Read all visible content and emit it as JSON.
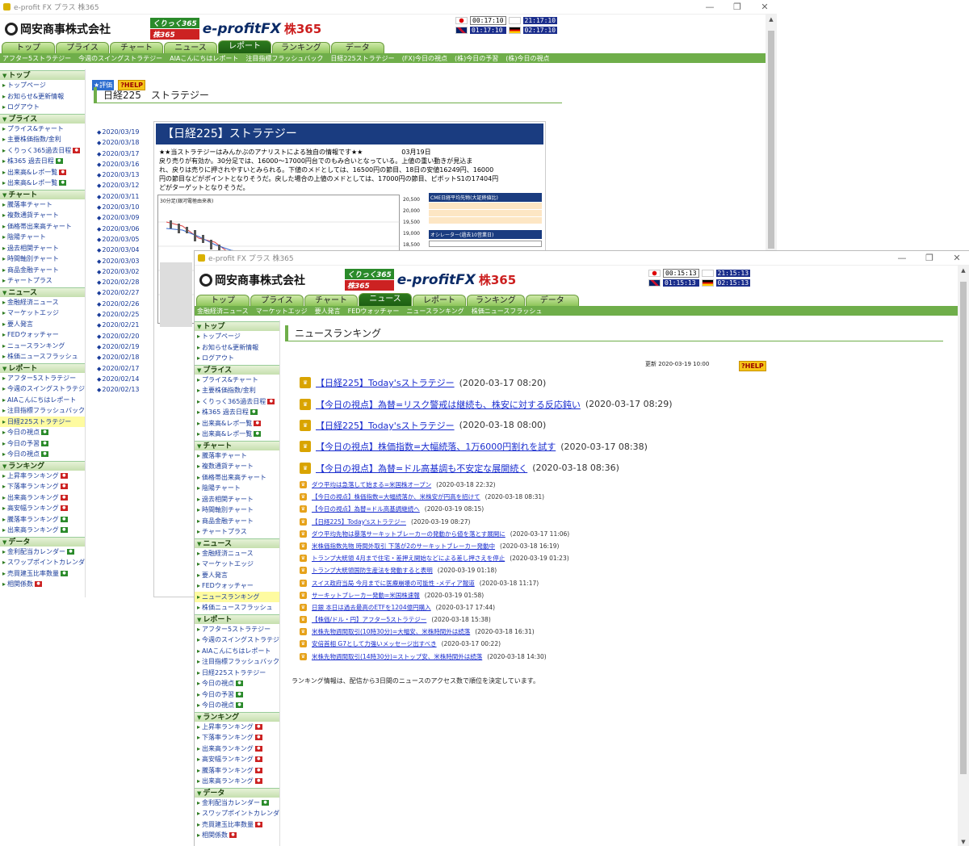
{
  "back": {
    "title": "e-profit FX プラス 株365",
    "company": "岡安商事株式会社",
    "brand": {
      "kurikku": "くりっく365",
      "kabu": "株365",
      "eprofit": "e-profitFX",
      "kabu365": "株365"
    },
    "clocks": [
      "00:17:10",
      "21:17:10",
      "01:17:10",
      "02:17:10"
    ],
    "tabs": [
      "トップ",
      "プライス",
      "チャート",
      "ニュース",
      "レポート",
      "ランキング",
      "データ"
    ],
    "subnav": [
      "アフター5ストラテジー",
      "今週のスイングストラテジー",
      "AIAこんにちはレポート",
      "注目指標フラッシュバック",
      "日経225ストラテジー",
      "(FX)今日の視点",
      "(株)今日の予習",
      "(株)今日の視点"
    ],
    "hyoka": "★評価",
    "help": "?HELP",
    "page_title": "日経225　ストラテジー",
    "dates": [
      "2020/03/19",
      "2020/03/18",
      "2020/03/17",
      "2020/03/16",
      "2020/03/13",
      "2020/03/12",
      "2020/03/11",
      "2020/03/10",
      "2020/03/09",
      "2020/03/06",
      "2020/03/05",
      "2020/03/04",
      "2020/03/03",
      "2020/03/02",
      "2020/02/28",
      "2020/02/27",
      "2020/02/26",
      "2020/02/25",
      "2020/02/21",
      "2020/02/20",
      "2020/02/19",
      "2020/02/18",
      "2020/02/17",
      "2020/02/14",
      "2020/02/13"
    ],
    "strat_banner": "【日経225】ストラテジー",
    "strat_lines": [
      "★★当ストラテジーはみんかぶのアナリストによる独自の情報です★★　　　　　　03月19日",
      "戻り売りが有効か。30分足では、16000～17000円台でのもみ合いとなっている。上値の重い動きが見込ま",
      "れ、戻りは売りに押されやすいとみられる。下値のメドとしては、16500円の節目、18日の安値16249円、16000",
      "円の節目などがポイントとなりそうだ。戻した場合の上値のメドとしては、17000円の節目、ピボットS1の17404円",
      "どがターゲットとなりそうだ。"
    ],
    "chart_heading": "30分足(銀河電極由来表)",
    "cme_heading": "CME日経平均先物(大証終値比)",
    "osc_heading": "オシレーター(過去10営業日)",
    "y_ticks": [
      "20,500",
      "20,000",
      "19,500",
      "19,000",
      "18,500"
    ],
    "sidebar": [
      {
        "sec": "トップ",
        "items": [
          {
            "t": "トップページ"
          },
          {
            "t": "お知らせ&更新情報"
          },
          {
            "t": "ログアウト"
          }
        ]
      },
      {
        "sec": "プライス",
        "items": [
          {
            "t": "プライス&チャート"
          },
          {
            "t": "主要株価指数/金利"
          },
          {
            "t": "くりっく365過去日程",
            "b": "r"
          },
          {
            "t": "株365 過去日程",
            "b": "g"
          },
          {
            "t": "出来高&レポ一覧",
            "b": "r"
          },
          {
            "t": "出来高&レポ一覧",
            "b": "g"
          }
        ]
      },
      {
        "sec": "チャート",
        "items": [
          {
            "t": "騰落率チャート"
          },
          {
            "t": "複数通貨チャート"
          },
          {
            "t": "価格帯出来高チャート"
          },
          {
            "t": "陰陽チャート"
          },
          {
            "t": "過去相関チャート"
          },
          {
            "t": "時間軸別チャート"
          },
          {
            "t": "商品金融チャート"
          },
          {
            "t": "チャートプラス"
          }
        ]
      },
      {
        "sec": "ニュース",
        "items": [
          {
            "t": "金融経済ニュース"
          },
          {
            "t": "マーケットエッジ"
          },
          {
            "t": "要人発言"
          },
          {
            "t": "FEDウォッチャー"
          },
          {
            "t": "ニュースランキング"
          },
          {
            "t": "株価ニュースフラッシュ"
          }
        ]
      },
      {
        "sec": "レポート",
        "items": [
          {
            "t": "アフター5ストラテジー"
          },
          {
            "t": "今週のスイングストラテジー"
          },
          {
            "t": "AIAこんにちはレポート"
          },
          {
            "t": "注目指標フラッシュバック"
          },
          {
            "t": "日経225ストラテジー",
            "hl": true
          },
          {
            "t": "今日の視点",
            "b": "g"
          },
          {
            "t": "今日の予習",
            "b": "g"
          },
          {
            "t": "今日の視点",
            "b": "g"
          }
        ]
      },
      {
        "sec": "ランキング",
        "items": [
          {
            "t": "上昇率ランキング",
            "b": "r"
          },
          {
            "t": "下落率ランキング",
            "b": "r"
          },
          {
            "t": "出来高ランキング",
            "b": "r"
          },
          {
            "t": "高安幅ランキング",
            "b": "r"
          },
          {
            "t": "騰落率ランキング",
            "b": "g"
          },
          {
            "t": "出来高ランキング",
            "b": "g"
          }
        ]
      },
      {
        "sec": "データ",
        "items": [
          {
            "t": "金利配当カレンダー",
            "b": "g"
          },
          {
            "t": "スワップポイントカレンダー",
            "b": "r"
          },
          {
            "t": "売買建玉比率数量",
            "b": "g"
          },
          {
            "t": "相関係数",
            "b": "r"
          }
        ]
      }
    ]
  },
  "front": {
    "title": "e-profit FX プラス 株365",
    "company": "岡安商事株式会社",
    "brand": {
      "kurikku": "くりっく365",
      "kabu": "株365",
      "eprofit": "e-profitFX",
      "kabu365": "株365"
    },
    "clocks": [
      "00:15:13",
      "21:15:13",
      "01:15:13",
      "02:15:13"
    ],
    "tabs": [
      "トップ",
      "プライス",
      "チャート",
      "ニュース",
      "レポート",
      "ランキング",
      "データ"
    ],
    "subnav": [
      "金融経済ニュース",
      "マーケットエッジ",
      "要人発言",
      "FEDウォッチャー",
      "ニュースランキング",
      "株価ニュースフラッシュ"
    ],
    "page_title": "ニュースランキング",
    "updated": "更新 2020-03-19 10:00",
    "help": "?HELP",
    "rankings": [
      {
        "title": "【日経225】Today'sストラテジー",
        "date": "(2020-03-17 08:20)"
      },
      {
        "title": "【今日の視点】為替=リスク警戒は継続も、株安に対する反応鈍い",
        "date": "(2020-03-17 08:29)"
      },
      {
        "title": "【日経225】Today'sストラテジー",
        "date": "(2020-03-18 08:00)"
      },
      {
        "title": "【今日の視点】株価指数=大幅続落、1万6000円割れを試す",
        "date": "(2020-03-17 08:38)"
      },
      {
        "title": "【今日の視点】為替=ドル高基調も不安定な展開続く",
        "date": "(2020-03-18 08:36)"
      },
      {
        "title": "ダウ平均は急落して始まる=米国株オープン",
        "date": "(2020-03-18 22:32)"
      },
      {
        "title": "【今日の視点】株価指数=大幅続落か、米株安が円高を招けて",
        "date": "(2020-03-18 08:31)"
      },
      {
        "title": "【今日の視点】為替=ドル高基調継続へ",
        "date": "(2020-03-19 08:15)"
      },
      {
        "title": "【日経225】Today'sストラテジー",
        "date": "(2020-03-19 08:27)"
      },
      {
        "title": "ダウ平均先物は暴落サーキットブレーカーの発動から値を落とす展開に",
        "date": "(2020-03-17 11:06)"
      },
      {
        "title": "米株価指数先物 時間外取引 下落が2のサーキットブレーカー発動中",
        "date": "(2020-03-18 16:19)"
      },
      {
        "title": "トランプ大統領 4月まで住宅・差押え開始などによる差し押さえを停止",
        "date": "(2020-03-19 01:23)"
      },
      {
        "title": "トランプ大統領国防生産法を発動すると表明",
        "date": "(2020-03-19 01:18)"
      },
      {
        "title": "スイス政府当局 今月までに医療崩壊の可能性 -メディア報道",
        "date": "(2020-03-18 11:17)"
      },
      {
        "title": "サーキットブレーカー発動=米国株速報",
        "date": "(2020-03-19 01:58)"
      },
      {
        "title": "日銀 本日は過去最高のETFを1204億円購入",
        "date": "(2020-03-17 17:44)"
      },
      {
        "title": "【株価/ドル・円】アフター5ストラテジー",
        "date": "(2020-03-18 15:38)"
      },
      {
        "title": "米株先物週間取引(10時30分)=大幅安、米株時間外は続落",
        "date": "(2020-03-18 16:31)"
      },
      {
        "title": "安倍首相 G7として力強いメッセージ出すべき",
        "date": "(2020-03-17 00:22)"
      },
      {
        "title": "米株先物週間取引(14時30分)=ストップ安、米株時間外は続落",
        "date": "(2020-03-18 14:30)"
      }
    ],
    "footnote": "ランキング情報は、配信から3日間のニュースのアクセス数で順位を決定しています。",
    "sidebar": [
      {
        "sec": "トップ",
        "items": [
          {
            "t": "トップページ"
          },
          {
            "t": "お知らせ&更新情報"
          },
          {
            "t": "ログアウト"
          }
        ]
      },
      {
        "sec": "プライス",
        "items": [
          {
            "t": "プライス&チャート"
          },
          {
            "t": "主要株価指数/金利"
          },
          {
            "t": "くりっく365過去日程",
            "b": "r"
          },
          {
            "t": "株365 過去日程",
            "b": "g"
          },
          {
            "t": "出来高&レポ一覧",
            "b": "r"
          },
          {
            "t": "出来高&レポ一覧",
            "b": "g"
          }
        ]
      },
      {
        "sec": "チャート",
        "items": [
          {
            "t": "騰落率チャート"
          },
          {
            "t": "複数通貨チャート"
          },
          {
            "t": "価格帯出来高チャート"
          },
          {
            "t": "陰陽チャート"
          },
          {
            "t": "過去相関チャート"
          },
          {
            "t": "時間軸別チャート"
          },
          {
            "t": "商品金融チャート"
          },
          {
            "t": "チャートプラス"
          }
        ]
      },
      {
        "sec": "ニュース",
        "items": [
          {
            "t": "金融経済ニュース"
          },
          {
            "t": "マーケットエッジ"
          },
          {
            "t": "要人発言"
          },
          {
            "t": "FEDウォッチャー"
          },
          {
            "t": "ニュースランキング",
            "hl": true
          },
          {
            "t": "株価ニュースフラッシュ"
          }
        ]
      },
      {
        "sec": "レポート",
        "items": [
          {
            "t": "アフター5ストラテジー"
          },
          {
            "t": "今週のスイングストラテジー"
          },
          {
            "t": "AIAこんにちはレポート"
          },
          {
            "t": "注目指標フラッシュバック"
          },
          {
            "t": "日経225ストラテジー"
          },
          {
            "t": "今日の視点",
            "b": "g"
          },
          {
            "t": "今日の予習",
            "b": "g"
          },
          {
            "t": "今日の視点",
            "b": "g"
          }
        ]
      },
      {
        "sec": "ランキング",
        "items": [
          {
            "t": "上昇率ランキング",
            "b": "r"
          },
          {
            "t": "下落率ランキング",
            "b": "r"
          },
          {
            "t": "出来高ランキング",
            "b": "r"
          },
          {
            "t": "高安幅ランキング",
            "b": "r"
          },
          {
            "t": "騰落率ランキング",
            "b": "r"
          },
          {
            "t": "出来高ランキング",
            "b": "r"
          }
        ]
      },
      {
        "sec": "データ",
        "items": [
          {
            "t": "金利配当カレンダー",
            "b": "g"
          },
          {
            "t": "スワップポイントカレンダー",
            "b": "r"
          },
          {
            "t": "売買建玉比率数量",
            "b": "r"
          },
          {
            "t": "相関係数",
            "b": "r"
          }
        ]
      }
    ],
    "colors": {
      "accent": "#6fae4a",
      "link": "#1a2dcf",
      "crown": "#d9a400",
      "clock_bg": "#1b2e8c"
    }
  }
}
